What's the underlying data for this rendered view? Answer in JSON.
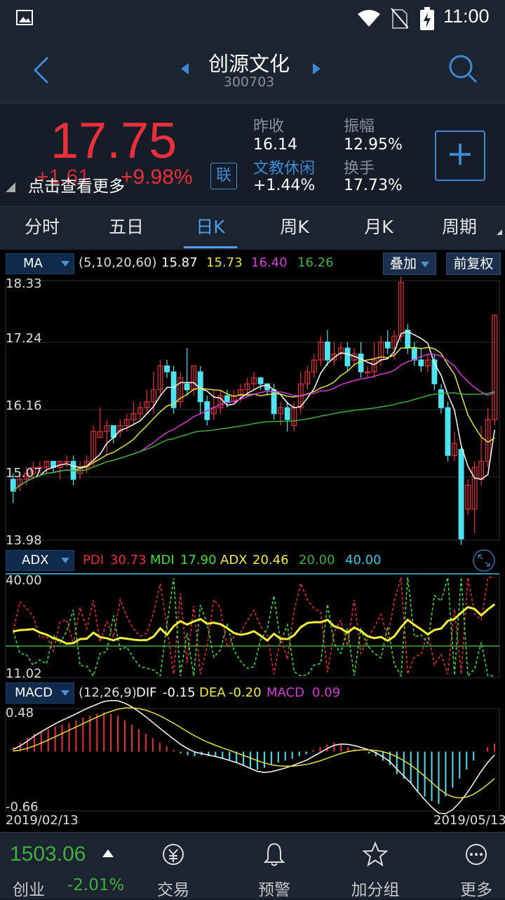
{
  "status": {
    "time": "11:00"
  },
  "header": {
    "name": "创源文化",
    "code": "300703"
  },
  "quote": {
    "price": "17.75",
    "change": "+1.61",
    "change_pct": "+9.98%",
    "hint": "点击查看更多",
    "link_label": "联",
    "prev_close_label": "昨收",
    "prev_close": "16.14",
    "industry": "文教休闲",
    "industry_change": "+1.44%",
    "amplitude_label": "振幅",
    "amplitude": "12.95%",
    "turnover_label": "换手",
    "turnover": "17.73%",
    "add_label": "+"
  },
  "tabs": [
    "分时",
    "五日",
    "日K",
    "周K",
    "月K",
    "周期"
  ],
  "active_tab": 2,
  "ma_bar": {
    "indicator": "MA",
    "params": "(5,10,20,60)",
    "ma5": "15.87",
    "ma10": "15.73",
    "ma20": "16.40",
    "ma60": "16.26",
    "overlay_btn": "叠加",
    "adjust_btn": "前复权"
  },
  "price_axis": [
    "18.33",
    "17.24",
    "16.16",
    "15.07",
    "13.98"
  ],
  "adx_bar": {
    "indicator": "ADX",
    "pdi_label": "PDI",
    "pdi": "30.73",
    "mdi_label": "MDI",
    "mdi": "17.90",
    "adx_label": "ADX",
    "adx": "20.46",
    "l1": "20.00",
    "l2": "40.00"
  },
  "adx_axis": [
    "40.00",
    "11.02"
  ],
  "macd_bar": {
    "indicator": "MACD",
    "params": "(12,26,9)",
    "dif_label": "DIF",
    "dif": "-0.15",
    "dea_label": "DEA",
    "dea": "-0.20",
    "macd_label": "MACD",
    "macd": "0.09"
  },
  "macd_axis": [
    "0.48",
    "-0.66"
  ],
  "dates": {
    "start": "2019/02/13",
    "end": "2019/05/13"
  },
  "bottom": {
    "index_value": "1503.06",
    "index_name": "创业",
    "index_change": "-2.01%",
    "nav": [
      "交易",
      "预警",
      "加分组",
      "更多"
    ]
  },
  "colors": {
    "up": "#e8303a",
    "down": "#4fe3f0",
    "ma5": "#ffffff",
    "ma10": "#e6e23a",
    "ma20": "#d63ad6",
    "ma60": "#3db03d",
    "accent": "#4da0e6"
  },
  "chart_data": {
    "type": "candlestick",
    "ylim": [
      13.98,
      18.33
    ],
    "candles": [
      [
        15.0,
        14.8,
        15.1,
        14.6
      ],
      [
        14.9,
        15.0,
        15.1,
        14.8
      ],
      [
        15.0,
        15.1,
        15.2,
        14.9
      ],
      [
        15.1,
        15.2,
        15.3,
        15.0
      ],
      [
        15.2,
        15.2,
        15.3,
        15.1
      ],
      [
        15.2,
        15.3,
        15.3,
        15.1
      ],
      [
        15.3,
        15.2,
        15.3,
        15.1
      ],
      [
        15.2,
        15.3,
        15.3,
        15.0
      ],
      [
        15.3,
        15.3,
        15.4,
        15.2
      ],
      [
        15.3,
        15.0,
        15.4,
        14.9
      ],
      [
        15.1,
        15.2,
        15.3,
        15.0
      ],
      [
        15.2,
        15.3,
        15.4,
        15.1
      ],
      [
        15.3,
        15.8,
        15.9,
        15.2
      ],
      [
        15.7,
        15.8,
        16.2,
        15.7
      ],
      [
        15.8,
        15.9,
        16.0,
        15.4
      ],
      [
        15.9,
        15.7,
        15.9,
        15.6
      ],
      [
        15.8,
        15.9,
        16.0,
        15.7
      ],
      [
        15.9,
        16.0,
        16.1,
        15.8
      ],
      [
        16.0,
        16.1,
        16.3,
        15.9
      ],
      [
        16.1,
        16.2,
        16.3,
        16.0
      ],
      [
        16.2,
        16.3,
        16.5,
        16.1
      ],
      [
        16.3,
        16.5,
        16.8,
        16.1
      ],
      [
        16.5,
        16.9,
        17.0,
        16.4
      ],
      [
        16.9,
        16.8,
        17.0,
        16.7
      ],
      [
        16.8,
        16.2,
        16.9,
        16.1
      ],
      [
        16.3,
        16.7,
        16.8,
        16.2
      ],
      [
        16.6,
        16.5,
        17.2,
        16.4
      ],
      [
        16.5,
        16.9,
        16.9,
        16.4
      ],
      [
        16.8,
        16.3,
        16.9,
        16.1
      ],
      [
        16.3,
        16.0,
        16.4,
        15.9
      ],
      [
        16.1,
        16.2,
        16.5,
        16.0
      ],
      [
        16.2,
        16.4,
        16.5,
        16.1
      ],
      [
        16.4,
        16.3,
        16.5,
        16.2
      ],
      [
        16.3,
        16.4,
        16.5,
        16.3
      ],
      [
        16.4,
        16.5,
        16.6,
        16.3
      ],
      [
        16.5,
        16.6,
        16.7,
        16.4
      ],
      [
        16.6,
        16.7,
        16.8,
        16.5
      ],
      [
        16.7,
        16.6,
        16.7,
        16.5
      ],
      [
        16.6,
        16.5,
        16.6,
        16.4
      ],
      [
        16.5,
        16.1,
        16.6,
        16.0
      ],
      [
        16.1,
        16.2,
        16.3,
        15.9
      ],
      [
        16.2,
        16.0,
        16.3,
        15.8
      ],
      [
        15.9,
        16.2,
        16.3,
        15.8
      ],
      [
        16.2,
        16.6,
        16.8,
        16.1
      ],
      [
        16.6,
        16.8,
        16.9,
        16.5
      ],
      [
        16.8,
        17.0,
        17.1,
        16.7
      ],
      [
        17.0,
        17.3,
        17.4,
        16.9
      ],
      [
        17.3,
        17.0,
        17.5,
        16.9
      ],
      [
        17.0,
        17.1,
        17.3,
        16.9
      ],
      [
        17.1,
        17.2,
        17.3,
        17.0
      ],
      [
        17.2,
        16.9,
        17.3,
        16.8
      ],
      [
        17.0,
        17.1,
        17.2,
        16.9
      ],
      [
        17.1,
        16.8,
        17.3,
        16.7
      ],
      [
        16.8,
        16.8,
        16.9,
        16.7
      ],
      [
        16.8,
        17.0,
        17.3,
        16.7
      ],
      [
        17.0,
        17.3,
        17.4,
        16.9
      ],
      [
        17.3,
        17.2,
        17.5,
        17.1
      ],
      [
        17.2,
        17.4,
        17.5,
        17.0
      ],
      [
        17.4,
        18.3,
        18.4,
        17.3
      ],
      [
        17.5,
        17.2,
        17.6,
        17.1
      ],
      [
        17.2,
        17.0,
        17.3,
        16.9
      ],
      [
        17.0,
        16.9,
        17.2,
        16.8
      ],
      [
        16.9,
        17.0,
        17.1,
        16.8
      ],
      [
        17.0,
        16.6,
        17.1,
        16.5
      ],
      [
        16.5,
        16.2,
        16.6,
        16.1
      ],
      [
        16.2,
        15.4,
        16.3,
        15.3
      ],
      [
        15.4,
        15.6,
        15.8,
        15.3
      ],
      [
        15.5,
        14.0,
        15.6,
        13.9
      ],
      [
        14.5,
        14.9,
        15.0,
        14.4
      ],
      [
        14.5,
        15.2,
        15.3,
        14.1
      ],
      [
        15.0,
        15.3,
        15.9,
        14.9
      ],
      [
        15.3,
        16.0,
        16.2,
        15.2
      ],
      [
        16.0,
        17.75,
        17.75,
        15.9
      ]
    ],
    "macd_hist": [
      0.05,
      0.1,
      0.15,
      0.2,
      0.22,
      0.25,
      0.28,
      0.3,
      0.32,
      0.35,
      0.38,
      0.4,
      0.42,
      0.44,
      0.42,
      0.4,
      0.35,
      0.3,
      0.25,
      0.2,
      0.15,
      0.1,
      0.06,
      0.02,
      -0.02,
      -0.04,
      -0.05,
      -0.04,
      -0.05,
      -0.06,
      -0.08,
      -0.1,
      -0.12,
      -0.15,
      -0.18,
      -0.2,
      -0.18,
      -0.15,
      -0.12,
      -0.1,
      -0.08,
      -0.05,
      -0.03,
      0.02,
      0.05,
      0.08,
      0.1,
      0.08,
      0.05,
      0.03,
      0.0,
      -0.02,
      -0.05,
      -0.1,
      -0.15,
      -0.25,
      -0.3,
      -0.35,
      -0.45,
      -0.5,
      -0.55,
      -0.58,
      -0.5,
      -0.4,
      -0.3,
      -0.2,
      -0.1,
      0.0,
      0.05,
      0.09
    ]
  }
}
